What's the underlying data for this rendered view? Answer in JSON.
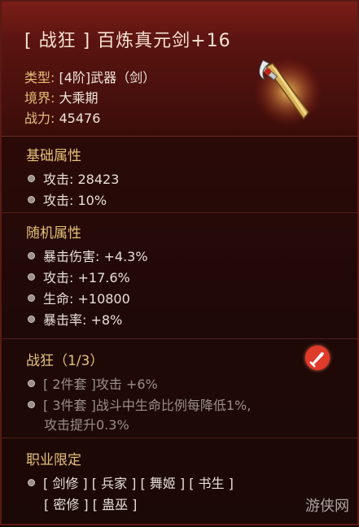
{
  "item": {
    "title": "[ 战狂 ] 百炼真元剑+16",
    "type_label": "类型:",
    "type_value": "[4阶]武器（剑）",
    "realm_label": "境界:",
    "realm_value": "大乘期",
    "power_label": "战力:",
    "power_value": "45476",
    "icon": "sword-icon"
  },
  "basic": {
    "heading": "基础属性",
    "rows": [
      "攻击: 28423",
      "攻击: 10%"
    ]
  },
  "random": {
    "heading": "随机属性",
    "rows": [
      "暴击伤害: +4.3%",
      "攻击: +17.6%",
      "生命: +10800",
      "暴击率: +8%"
    ]
  },
  "set": {
    "heading": "战狂（1/3）",
    "icon": "red-sword-badge-icon",
    "row1_tag": "[ 2件套 ]",
    "row1_text": " 攻击 +6%",
    "row2_tag": "[ 3件套 ]",
    "row2_text": " 战斗中生命比例每降低1%,",
    "row2_cont": "攻击提升0.3%"
  },
  "classes": {
    "heading": "职业限定",
    "line1": "[ 剑修 ] [ 兵家 ] [ 舞姬 ] [ 书生 ]",
    "line2": "[ 密修 ] [ 蛊巫 ]"
  },
  "watermark": "游侠网",
  "colors": {
    "accent": "#e6c07a",
    "badge": "#e03a2a"
  }
}
